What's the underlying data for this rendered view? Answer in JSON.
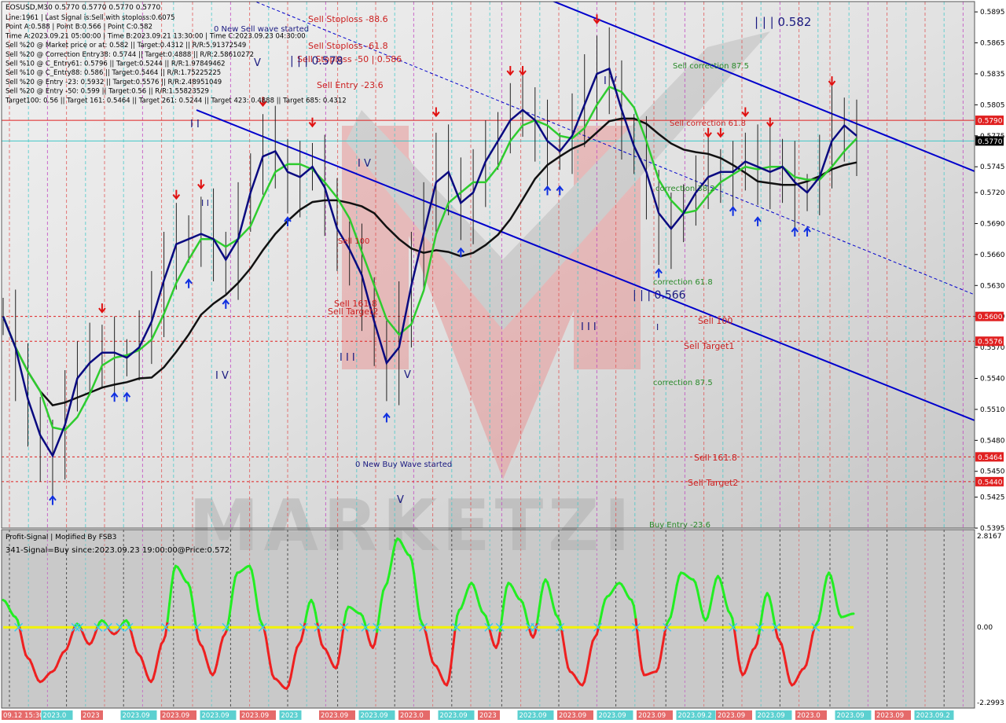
{
  "symbol_header": "EOSUSD,M30  0.5770 0.5770 0.5770 0.5770",
  "info_lines": [
    "Line:1961 | Last Signal is:Sell with stoploss:0.6075",
    "Point A:0.588 | Point B:0.566 | Point C:0.582",
    "Time A:2023.09.21 05:00:00 | Time B:2023.09.21 13:30:00 | Time C:2023.09.23 04:30:00",
    "Sell %20 @ Market price or at: 0.582 || Target:0.4312 || R/R:5.91372549",
    "Sell %20 @ Correction Entry38: 0.5744 || Target:0.4888 || R/R:2.58610272",
    "Sell %10 @ C_Entry61: 0.5796 || Target:0.5244 || R/R:1.97849462",
    "Sell %10 @ C_Entry88: 0.586 || Target:0.5464 || R/R:1.75225225",
    "Sell %20 @ Entry -23: 0.5932 || Target:0.5576 || R/R:2.48951049",
    "Sell %20 @ Entry -50: 0.599 || Target:0.56 || R/R:1.55823529",
    "Target100: 0.56 || Target 161: 0.5464 || Target 261: 0.5244 || Target 423: 0.4888 || Target 685: 0.4312"
  ],
  "annotations": [
    {
      "text": "0 New Sell wave started",
      "color": "#1a1a80"
    },
    {
      "text": "Sell Stoploss -88.6",
      "color": "#cc2020"
    },
    {
      "text": "Sell Stoploss -61.8",
      "color": "#cc2020"
    },
    {
      "text": "Sell Stoploss -50 | 0.586",
      "color": "#cc2020"
    },
    {
      "text": "| | | 0.578",
      "color": "#1a1a80"
    },
    {
      "text": "Sell Entry -23.6",
      "color": "#cc2020"
    },
    {
      "text": "| | | 0.582",
      "color": "#1a1a80"
    },
    {
      "text": "Sell correction 87.5",
      "color": "#2a8a2a"
    },
    {
      "text": "Sell correction 61.8",
      "color": "#cc2020"
    },
    {
      "text": "correction 38.2",
      "color": "#2a8a2a"
    },
    {
      "text": "correction 61.8",
      "color": "#2a8a2a"
    },
    {
      "text": "| | | 0.566",
      "color": "#1a1a80"
    },
    {
      "text": "Sell 100",
      "color": "#cc2020"
    },
    {
      "text": "Sell Target1",
      "color": "#cc2020"
    },
    {
      "text": "correction 87.5",
      "color": "#2a8a2a"
    },
    {
      "text": "Sell 161.8",
      "color": "#cc2020"
    },
    {
      "text": "Sell Target2",
      "color": "#cc2020"
    },
    {
      "text": "Buy Entry -23.6",
      "color": "#2a8a2a"
    },
    {
      "text": "Sell 161.8",
      "color": "#cc2020"
    },
    {
      "text": "Sell Target2",
      "color": "#cc2020"
    },
    {
      "text": "Sell 100",
      "color": "#cc2020"
    },
    {
      "text": "0 New Buy Wave started",
      "color": "#1a1a80"
    },
    {
      "text": "I V",
      "color": "#1a1a80"
    },
    {
      "text": "I V",
      "color": "#1a1a80"
    },
    {
      "text": "V",
      "color": "#1a1a80"
    },
    {
      "text": "I I I",
      "color": "#1a1a80"
    },
    {
      "text": "I I",
      "color": "#1a1a80"
    },
    {
      "text": "I V",
      "color": "#1a1a80"
    },
    {
      "text": "V",
      "color": "#1a1a80"
    },
    {
      "text": "I I I",
      "color": "#1a1a80"
    },
    {
      "text": "V",
      "color": "#1a1a80"
    },
    {
      "text": "I I",
      "color": "#1a1a80"
    },
    {
      "text": "I",
      "color": "#1a1a80"
    }
  ],
  "price_axis": {
    "ticks": [
      "0.5895",
      "0.5865",
      "0.5835",
      "0.5805",
      "0.5775",
      "0.5745",
      "0.5720",
      "0.5690",
      "0.5660",
      "0.5630",
      "0.5600",
      "0.5570",
      "0.5540",
      "0.5510",
      "0.5480",
      "0.5450",
      "0.5425",
      "0.5395"
    ],
    "markers": [
      {
        "value": "0.5790",
        "color": "#e02020"
      },
      {
        "value": "0.5770",
        "color": "#000000"
      },
      {
        "value": "0.5600",
        "color": "#e02020"
      },
      {
        "value": "0.5576",
        "color": "#e02020"
      },
      {
        "value": "0.5464",
        "color": "#e02020"
      },
      {
        "value": "0.5440",
        "color": "#e02020"
      }
    ]
  },
  "indicator": {
    "title": "Profit-Signal | Modified By FSB3",
    "subtitle": "341-Signal=Buy since:2023.09.23 19:00:00@Price:0.572",
    "axis_ticks": [
      "2.8167",
      "0.00",
      "-2.2993"
    ]
  },
  "time_labels": [
    "09.12 15:30 2",
    "2023.0",
    "2023",
    "2023.09",
    "2023.09",
    "2023.09",
    "2023.09",
    "2023",
    "2023.09",
    "2023.09",
    "2023.0",
    "2023.09",
    "2023",
    "2023.09",
    "2023.09",
    "2023.09",
    "2023.09",
    "2023.09.2",
    "2023.09",
    "2023.09",
    "2023.0",
    "2023.09",
    "2023.09",
    "2023.09.2"
  ],
  "colors": {
    "price_bg": "#d6d6d6",
    "indicator_bg": "#c8c8c8",
    "channel": "#0000cc",
    "ma_slow": "#111111",
    "ma_mid": "#0a0a80",
    "ma_fast": "#2ecc2e",
    "osc_pos": "#22ee22",
    "osc_neg": "#ee2020",
    "zero_line": "#f2f200",
    "resistance": "#e02020"
  },
  "chart_data": [
    {
      "type": "line",
      "title": "EOSUSD,M30",
      "y_range": [
        0.5395,
        0.5905
      ],
      "horizontal_levels": [
        0.579,
        0.56,
        0.5576,
        0.5464,
        0.544
      ],
      "series": [
        {
          "name": "close",
          "values": [
            0.56,
            0.554,
            0.55,
            0.547,
            0.546,
            0.553,
            0.555,
            0.556,
            0.557,
            0.556,
            0.556,
            0.558,
            0.561,
            0.566,
            0.568,
            0.567,
            0.569,
            0.566,
            0.565,
            0.57,
            0.574,
            0.577,
            0.575,
            0.573,
            0.574,
            0.575,
            0.57,
            0.567,
            0.566,
            0.562,
            0.557,
            0.554,
            0.56,
            0.566,
            0.57,
            0.576,
            0.572,
            0.57,
            0.574,
            0.576,
            0.578,
            0.58,
            0.58,
            0.578,
            0.576,
            0.576,
            0.579,
            0.582,
            0.585,
            0.583,
            0.577,
            0.576,
            0.572,
            0.568,
            0.569,
            0.571,
            0.573,
            0.574,
            0.574,
            0.574,
            0.576,
            0.573,
            0.575,
            0.574,
            0.572,
            0.572,
            0.575,
            0.579,
            0.578,
            0.577
          ]
        }
      ]
    },
    {
      "type": "line",
      "title": "Profit-Signal",
      "y_range": [
        -2.2993,
        2.8167
      ],
      "series": [
        {
          "name": "oscillator",
          "values": [
            0.8,
            0.3,
            -0.9,
            -1.6,
            -1.3,
            -0.7,
            0.1,
            -0.5,
            0.2,
            -0.2,
            0.2,
            -0.8,
            -1.6,
            -0.4,
            1.8,
            1.3,
            -0.5,
            -1.4,
            -0.2,
            1.6,
            1.8,
            0.1,
            -1.5,
            -1.8,
            -0.5,
            0.8,
            -0.6,
            -1.2,
            0.6,
            0.4,
            -0.6,
            1.2,
            2.6,
            2.1,
            0.1,
            -1.1,
            -1.7,
            0.5,
            1.3,
            0.4,
            -0.6,
            1.3,
            0.8,
            -0.3,
            1.4,
            0.3,
            -1.3,
            -1.7,
            -0.3,
            0.9,
            1.3,
            0.8,
            -1.4,
            -1.3,
            0.2,
            1.6,
            1.4,
            0.2,
            1.5,
            0.4,
            -1.4,
            -0.6,
            1.0,
            -0.4,
            -1.7,
            -1.2,
            0.1,
            1.6,
            0.3,
            0.4
          ]
        }
      ]
    }
  ]
}
